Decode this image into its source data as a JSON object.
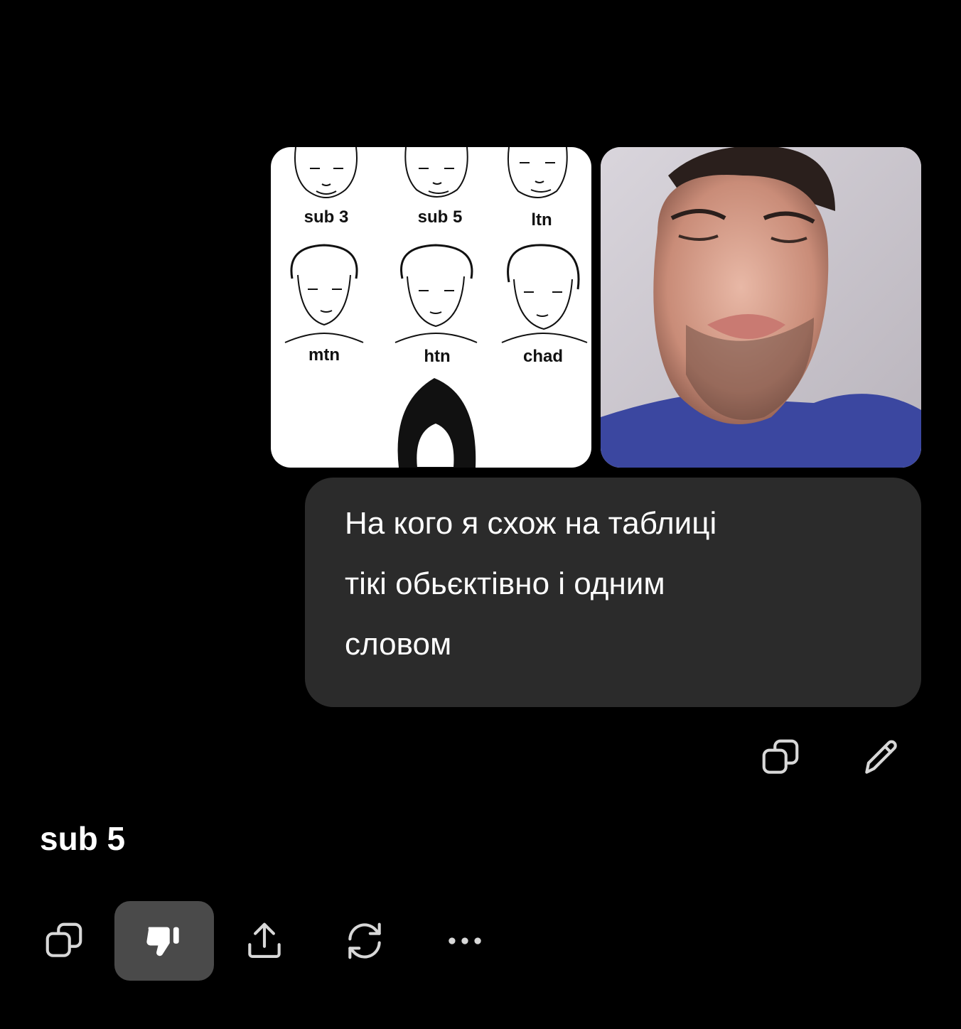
{
  "attachments": {
    "chart_labels": [
      "sub 3",
      "sub 5",
      "ltn",
      "mtn",
      "htn",
      "chad"
    ],
    "chart_icon": "face-chart-image",
    "photo_icon": "selfie-photo-image"
  },
  "user_message": {
    "line1": "На кого я схож на таблиці",
    "line2": "тікі обьєктівно і одним",
    "line3": "словом"
  },
  "user_actions": {
    "copy_icon": "copy-icon",
    "edit_icon": "pencil-icon"
  },
  "assistant_message": {
    "text": "sub 5"
  },
  "assistant_actions": {
    "copy_icon": "copy-icon",
    "dislike_icon": "thumbs-down-icon",
    "share_icon": "share-icon",
    "regenerate_icon": "refresh-icon",
    "more_icon": "more-icon"
  },
  "colors": {
    "background": "#000000",
    "bubble": "#2b2b2b",
    "active_button": "#4a4a4a",
    "icon": "#d8d8d8"
  }
}
